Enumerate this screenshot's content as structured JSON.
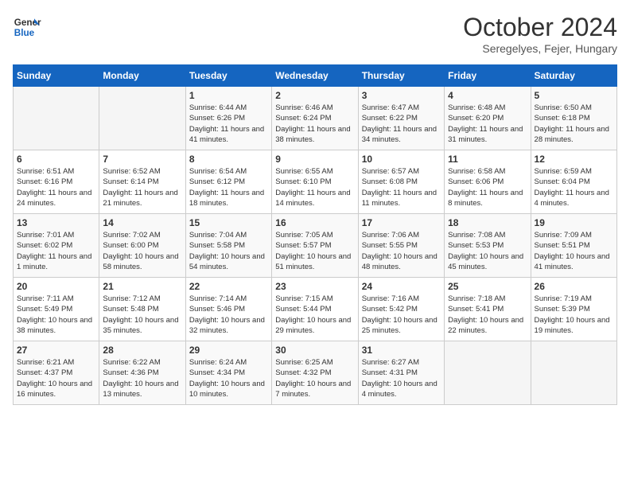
{
  "header": {
    "logo_general": "General",
    "logo_blue": "Blue",
    "month_title": "October 2024",
    "subtitle": "Seregelyes, Fejer, Hungary"
  },
  "weekdays": [
    "Sunday",
    "Monday",
    "Tuesday",
    "Wednesday",
    "Thursday",
    "Friday",
    "Saturday"
  ],
  "weeks": [
    [
      {
        "day": "",
        "info": ""
      },
      {
        "day": "",
        "info": ""
      },
      {
        "day": "1",
        "info": "Sunrise: 6:44 AM\nSunset: 6:26 PM\nDaylight: 11 hours and 41 minutes."
      },
      {
        "day": "2",
        "info": "Sunrise: 6:46 AM\nSunset: 6:24 PM\nDaylight: 11 hours and 38 minutes."
      },
      {
        "day": "3",
        "info": "Sunrise: 6:47 AM\nSunset: 6:22 PM\nDaylight: 11 hours and 34 minutes."
      },
      {
        "day": "4",
        "info": "Sunrise: 6:48 AM\nSunset: 6:20 PM\nDaylight: 11 hours and 31 minutes."
      },
      {
        "day": "5",
        "info": "Sunrise: 6:50 AM\nSunset: 6:18 PM\nDaylight: 11 hours and 28 minutes."
      }
    ],
    [
      {
        "day": "6",
        "info": "Sunrise: 6:51 AM\nSunset: 6:16 PM\nDaylight: 11 hours and 24 minutes."
      },
      {
        "day": "7",
        "info": "Sunrise: 6:52 AM\nSunset: 6:14 PM\nDaylight: 11 hours and 21 minutes."
      },
      {
        "day": "8",
        "info": "Sunrise: 6:54 AM\nSunset: 6:12 PM\nDaylight: 11 hours and 18 minutes."
      },
      {
        "day": "9",
        "info": "Sunrise: 6:55 AM\nSunset: 6:10 PM\nDaylight: 11 hours and 14 minutes."
      },
      {
        "day": "10",
        "info": "Sunrise: 6:57 AM\nSunset: 6:08 PM\nDaylight: 11 hours and 11 minutes."
      },
      {
        "day": "11",
        "info": "Sunrise: 6:58 AM\nSunset: 6:06 PM\nDaylight: 11 hours and 8 minutes."
      },
      {
        "day": "12",
        "info": "Sunrise: 6:59 AM\nSunset: 6:04 PM\nDaylight: 11 hours and 4 minutes."
      }
    ],
    [
      {
        "day": "13",
        "info": "Sunrise: 7:01 AM\nSunset: 6:02 PM\nDaylight: 11 hours and 1 minute."
      },
      {
        "day": "14",
        "info": "Sunrise: 7:02 AM\nSunset: 6:00 PM\nDaylight: 10 hours and 58 minutes."
      },
      {
        "day": "15",
        "info": "Sunrise: 7:04 AM\nSunset: 5:58 PM\nDaylight: 10 hours and 54 minutes."
      },
      {
        "day": "16",
        "info": "Sunrise: 7:05 AM\nSunset: 5:57 PM\nDaylight: 10 hours and 51 minutes."
      },
      {
        "day": "17",
        "info": "Sunrise: 7:06 AM\nSunset: 5:55 PM\nDaylight: 10 hours and 48 minutes."
      },
      {
        "day": "18",
        "info": "Sunrise: 7:08 AM\nSunset: 5:53 PM\nDaylight: 10 hours and 45 minutes."
      },
      {
        "day": "19",
        "info": "Sunrise: 7:09 AM\nSunset: 5:51 PM\nDaylight: 10 hours and 41 minutes."
      }
    ],
    [
      {
        "day": "20",
        "info": "Sunrise: 7:11 AM\nSunset: 5:49 PM\nDaylight: 10 hours and 38 minutes."
      },
      {
        "day": "21",
        "info": "Sunrise: 7:12 AM\nSunset: 5:48 PM\nDaylight: 10 hours and 35 minutes."
      },
      {
        "day": "22",
        "info": "Sunrise: 7:14 AM\nSunset: 5:46 PM\nDaylight: 10 hours and 32 minutes."
      },
      {
        "day": "23",
        "info": "Sunrise: 7:15 AM\nSunset: 5:44 PM\nDaylight: 10 hours and 29 minutes."
      },
      {
        "day": "24",
        "info": "Sunrise: 7:16 AM\nSunset: 5:42 PM\nDaylight: 10 hours and 25 minutes."
      },
      {
        "day": "25",
        "info": "Sunrise: 7:18 AM\nSunset: 5:41 PM\nDaylight: 10 hours and 22 minutes."
      },
      {
        "day": "26",
        "info": "Sunrise: 7:19 AM\nSunset: 5:39 PM\nDaylight: 10 hours and 19 minutes."
      }
    ],
    [
      {
        "day": "27",
        "info": "Sunrise: 6:21 AM\nSunset: 4:37 PM\nDaylight: 10 hours and 16 minutes."
      },
      {
        "day": "28",
        "info": "Sunrise: 6:22 AM\nSunset: 4:36 PM\nDaylight: 10 hours and 13 minutes."
      },
      {
        "day": "29",
        "info": "Sunrise: 6:24 AM\nSunset: 4:34 PM\nDaylight: 10 hours and 10 minutes."
      },
      {
        "day": "30",
        "info": "Sunrise: 6:25 AM\nSunset: 4:32 PM\nDaylight: 10 hours and 7 minutes."
      },
      {
        "day": "31",
        "info": "Sunrise: 6:27 AM\nSunset: 4:31 PM\nDaylight: 10 hours and 4 minutes."
      },
      {
        "day": "",
        "info": ""
      },
      {
        "day": "",
        "info": ""
      }
    ]
  ]
}
